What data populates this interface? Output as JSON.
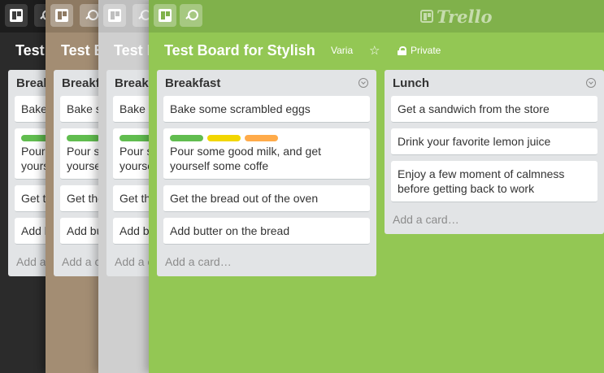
{
  "logo": {
    "text": "Trello"
  },
  "board": {
    "title": "Test Board for Stylish",
    "org": "Varia",
    "star": "☆",
    "privacy": "Private"
  },
  "lists": [
    {
      "title": "Breakfast",
      "cards": [
        {
          "text": "Bake some scrambled eggs",
          "labels": []
        },
        {
          "text": "Pour some good milk, and get yourself some coffe",
          "labels": [
            "#61bd4f",
            "#f2d600",
            "#ffab4a"
          ]
        },
        {
          "text": "Get the bread out of the oven",
          "labels": []
        },
        {
          "text": "Add butter on the bread",
          "labels": []
        }
      ],
      "add_card": "Add a card…"
    },
    {
      "title": "Lunch",
      "cards": [
        {
          "text": "Get a sandwich from the store",
          "labels": []
        },
        {
          "text": "Drink your favorite lemon juice",
          "labels": []
        },
        {
          "text": "Enjoy a few moment of calmness before getting back to work",
          "labels": []
        }
      ],
      "add_card": "Add a card…"
    }
  ],
  "colors": {
    "theme_dark": "#2b2b2b",
    "theme_brown": "#a38d73",
    "theme_gray": "#cfcfcf",
    "theme_green": "#93c754",
    "label_green": "#61bd4f",
    "label_yellow": "#f2d600",
    "label_orange": "#ffab4a"
  }
}
